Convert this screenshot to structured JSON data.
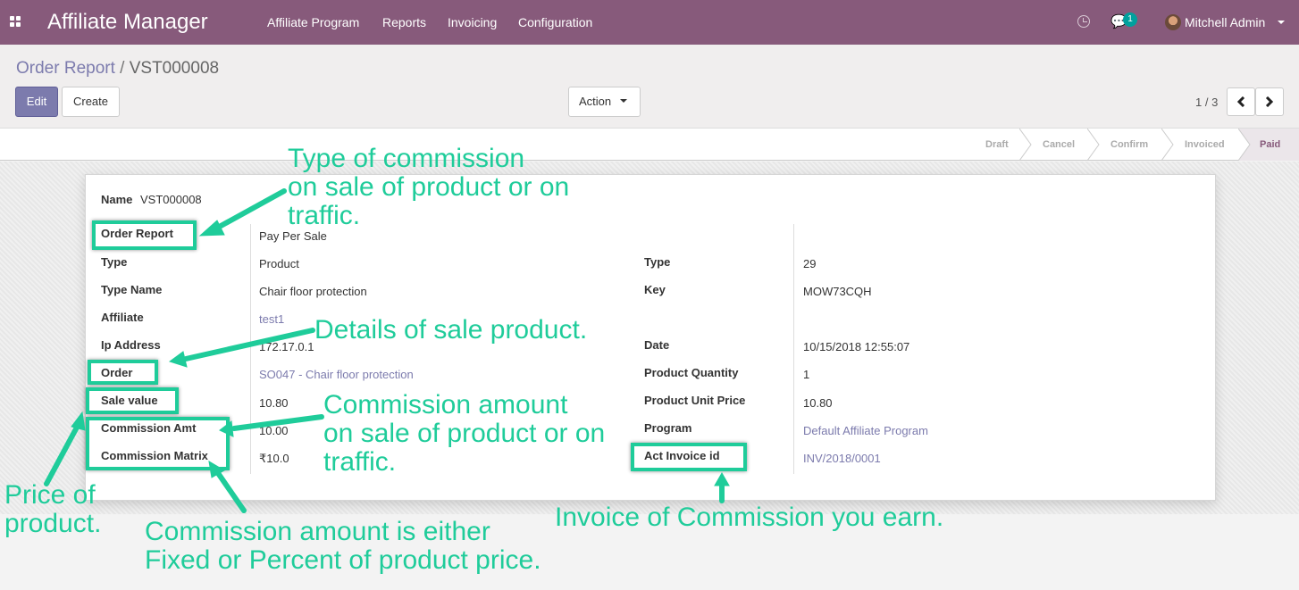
{
  "navbar": {
    "app_title": "Affiliate Manager",
    "menu": [
      "Affiliate Program",
      "Reports",
      "Invoicing",
      "Configuration"
    ],
    "chat_count": "1",
    "user": "Mitchell Admin"
  },
  "control_panel": {
    "breadcrumb_parent": "Order Report",
    "breadcrumb_sep": "/",
    "breadcrumb_current": "VST000008",
    "edit_label": "Edit",
    "create_label": "Create",
    "action_label": "Action",
    "pager": "1 / 3"
  },
  "statusbar": {
    "stages": [
      "Draft",
      "Cancel",
      "Confirm",
      "Invoiced",
      "Paid"
    ],
    "active": "Paid"
  },
  "form": {
    "name_label": "Name",
    "name_value": "VST000008",
    "left": [
      {
        "label": "Order Report",
        "value": "Pay Per Sale"
      },
      {
        "label": "Type",
        "value": "Product"
      },
      {
        "label": "Type Name",
        "value": "Chair floor protection"
      },
      {
        "label": "Affiliate",
        "value": "test1"
      },
      {
        "label": "Ip Address",
        "value": "172.17.0.1"
      },
      {
        "label": "Order",
        "value": "SO047 - Chair floor protection"
      },
      {
        "label": "Sale value",
        "value": "10.80"
      },
      {
        "label": "Commission Amt",
        "value": "10.00"
      },
      {
        "label": "Commission Matrix",
        "value": "₹10.0"
      }
    ],
    "right": [
      {
        "label": "Type",
        "value": "29"
      },
      {
        "label": "Key",
        "value": "MOW73CQH"
      },
      {
        "label": "Date",
        "value": "10/15/2018 12:55:07"
      },
      {
        "label": "Product Quantity",
        "value": "1"
      },
      {
        "label": "Product Unit Price",
        "value": "10.80"
      },
      {
        "label": "Program",
        "value": "Default Affiliate Program"
      },
      {
        "label": "Act Invoice id",
        "value": "INV/2018/0001"
      }
    ]
  },
  "annotations": {
    "type_commission": "Type of commission\non sale of product or on\ntraffic.",
    "details_sale": "Details of sale product.",
    "commission_amount": "Commission amount\non sale of product or on\ntraffic.",
    "price_product": "Price of\nproduct.",
    "commission_either": "Commission amount is either\nFixed or Percent of product price.",
    "invoice": "Invoice of Commission you earn."
  },
  "colors": {
    "navbar": "#875a7b",
    "primary": "#7c7bad",
    "annotation": "#1fcc9a"
  }
}
